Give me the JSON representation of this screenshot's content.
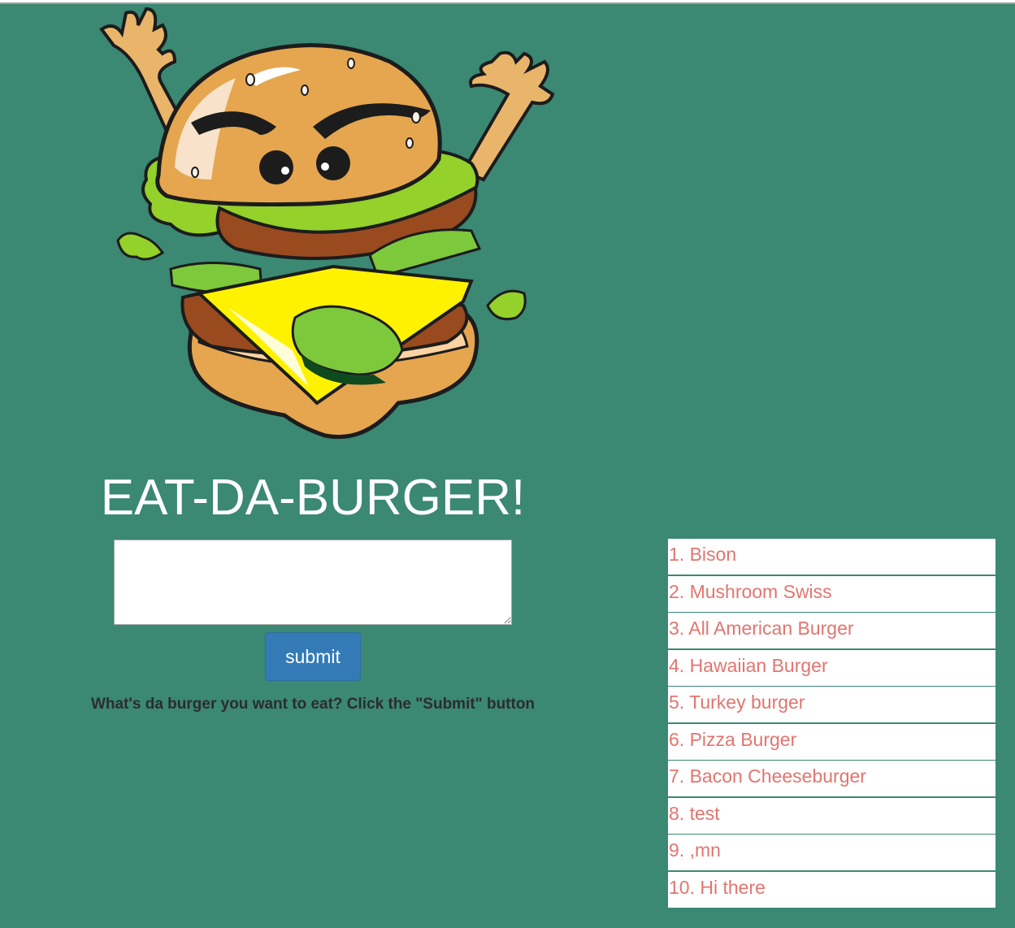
{
  "header": {
    "title": "EAT-DA-BURGER!"
  },
  "form": {
    "input_value": "",
    "submit_label": "submit",
    "instructions": "What's da burger you want to eat? Click the \"Submit\" button"
  },
  "burgers": [
    "1. Bison",
    "2. Mushroom Swiss",
    "3. All American Burger",
    "4. Hawaiian Burger",
    "5. Turkey burger",
    "6. Pizza Burger",
    "7. Bacon Cheeseburger",
    "8. test",
    "9. ,mn",
    "10. Hi there"
  ],
  "colors": {
    "background": "#3b8873",
    "button": "#337ab7",
    "list_text": "#e2756f"
  },
  "icons": {
    "mascot": "angry-burger-mascot-illustration"
  }
}
